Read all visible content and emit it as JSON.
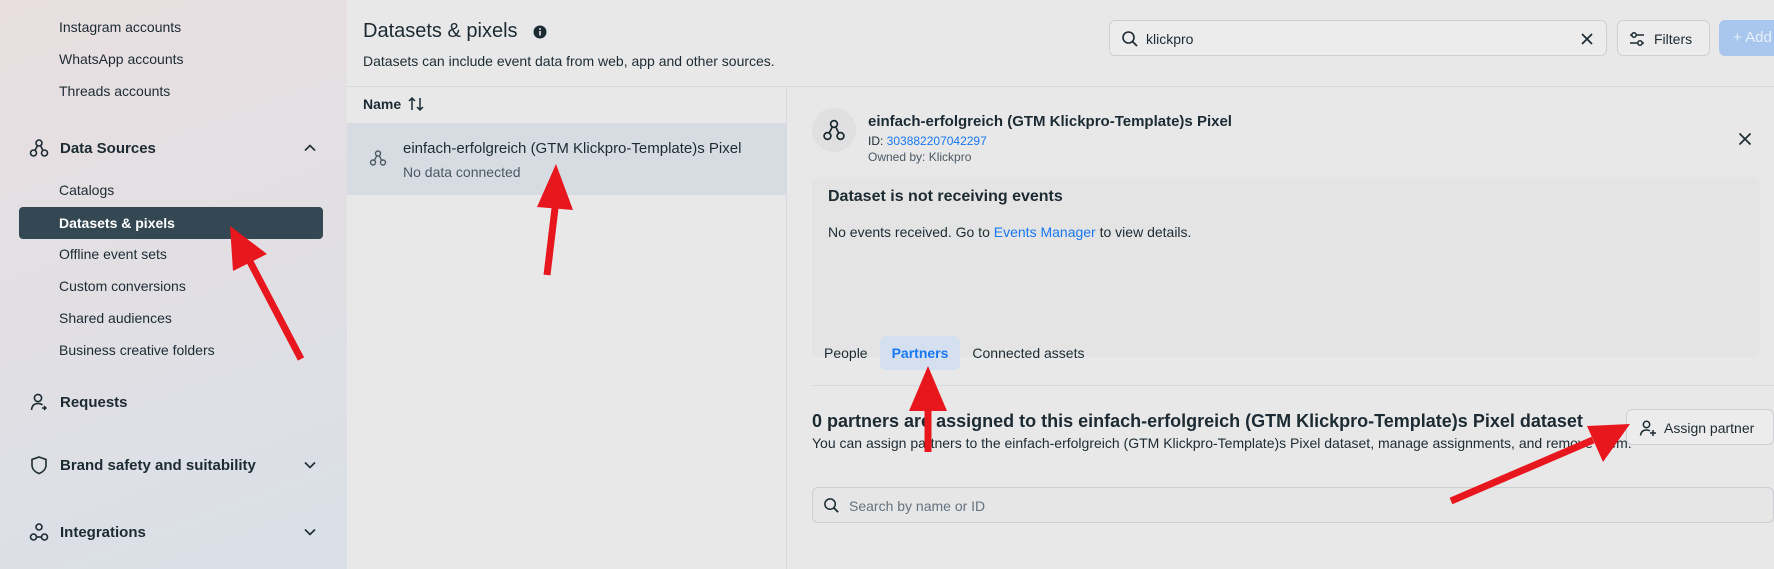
{
  "sidebar": {
    "top_items": [
      "Instagram accounts",
      "WhatsApp accounts",
      "Threads accounts"
    ],
    "data_sources": {
      "label": "Data Sources",
      "items": [
        "Catalogs",
        "Datasets & pixels",
        "Offline event sets",
        "Custom conversions",
        "Shared audiences",
        "Business creative folders"
      ],
      "active": "Datasets & pixels"
    },
    "requests": "Requests",
    "brand_safety": "Brand safety and suitability",
    "integrations": "Integrations"
  },
  "header": {
    "title": "Datasets & pixels",
    "subtitle": "Datasets can include event data from web, app and other sources.",
    "search_value": "klickpro",
    "filters_label": "Filters",
    "add_label": "+ Add"
  },
  "list": {
    "column_label": "Name",
    "rows": [
      {
        "name": "einfach-erfolgreich (GTM Klickpro-Template)s Pixel",
        "status": "No data connected"
      }
    ]
  },
  "detail": {
    "title": "einfach-erfolgreich (GTM Klickpro-Template)s Pixel",
    "id_label": "ID: ",
    "id_value": "303882207042297",
    "owner": "Owned by: Klickpro",
    "alert_title": "Dataset is not receiving events",
    "alert_body_pre": "No events received. Go to ",
    "alert_link": "Events Manager",
    "alert_body_post": " to view details.",
    "tabs": [
      "People",
      "Partners",
      "Connected assets"
    ],
    "active_tab": "Partners",
    "partners_title": "0 partners are assigned to this einfach-erfolgreich (GTM Klickpro-Template)s Pixel dataset",
    "partners_desc": "You can assign partners to the einfach-erfolgreich (GTM Klickpro-Template)s Pixel dataset, manage assignments, and remove them.",
    "assign_label": "Assign partner",
    "search_placeholder": "Search by name or ID"
  },
  "colors": {
    "accent": "#1877f2",
    "active_nav": "#344854",
    "annotation_arrow": "#e8161d"
  }
}
